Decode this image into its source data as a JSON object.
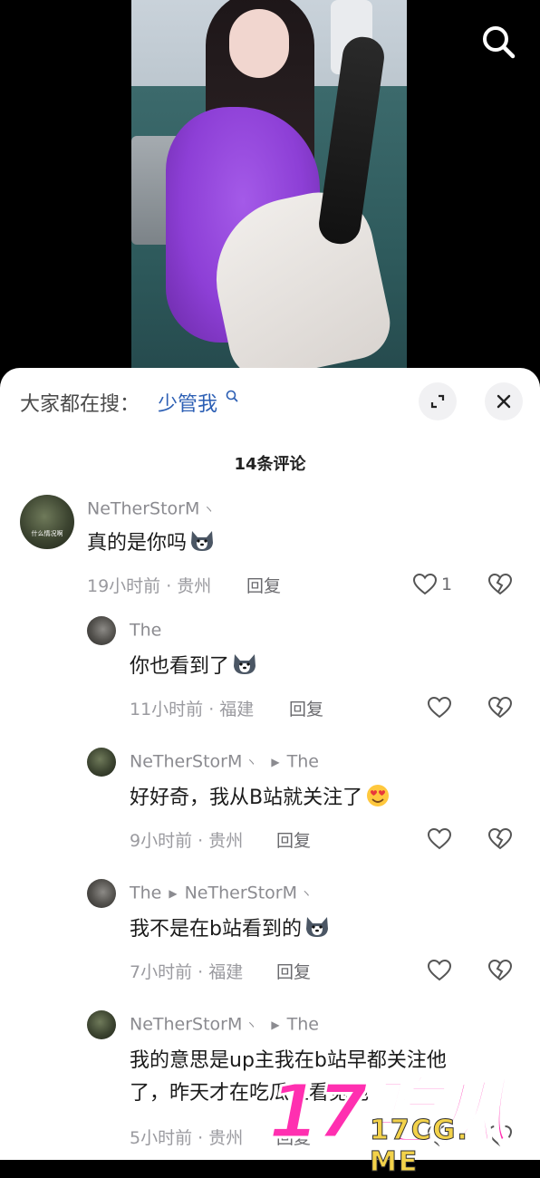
{
  "video": {
    "search_icon": "search-icon"
  },
  "suggestion": {
    "label": "大家都在搜：",
    "term": "少管我"
  },
  "comments_count": "14条评论",
  "comments": [
    {
      "username": "NeTherStorM",
      "avatar_caption": "什么情况啊",
      "text": "真的是你吗",
      "emoji": "husky-emoji",
      "time_location": "19小时前 · 贵州",
      "reply_label": "回复",
      "likes": "1"
    },
    {
      "username": "The",
      "text": "你也看到了",
      "emoji": "husky-emoji",
      "time_location": "11小时前 · 福建",
      "reply_label": "回复"
    },
    {
      "username": "NeTherStorM",
      "reply_to": "The",
      "text": "好好奇，我从B站就关注了",
      "emoji": "heart-eyes-emoji",
      "time_location": "9小时前 · 贵州",
      "reply_label": "回复"
    },
    {
      "username": "The",
      "reply_to": "NeTherStorM",
      "text": "我不是在b站看到的",
      "emoji": "husky-emoji",
      "time_location": "7小时前 · 福建",
      "reply_label": "回复"
    },
    {
      "username": "NeTherStorM",
      "reply_to": "The",
      "text_line1": "我的意思是up主我在b站早都关注他",
      "text_line2": "了，昨天才在吃瓜上看见他",
      "time_location": "5小时前 · 贵州",
      "reply_label": "回复"
    }
  ],
  "watermark": {
    "main": "17吃瓜",
    "sub": "17CG. ME"
  },
  "colors": {
    "accent_link": "#2c5fb4",
    "watermark_pink": "#ff2fb0",
    "watermark_yellow": "#f3d24a"
  }
}
